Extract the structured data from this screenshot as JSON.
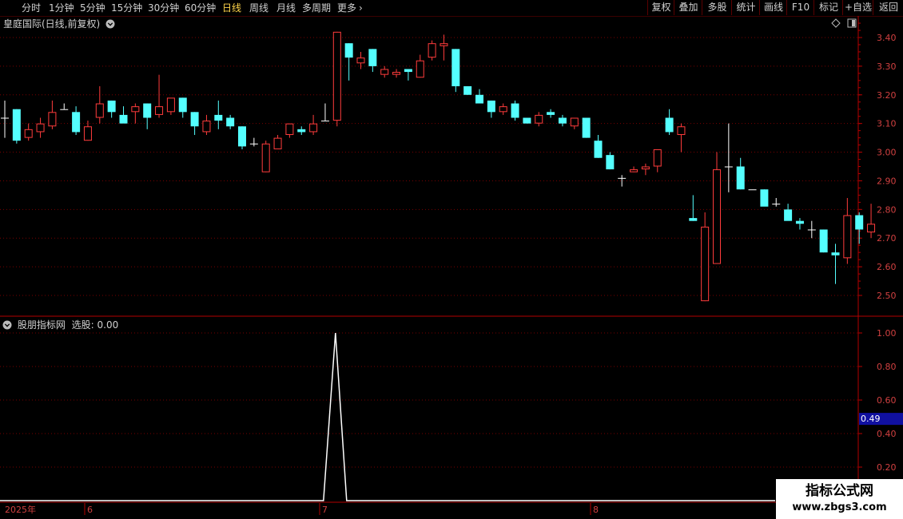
{
  "toolbar": {
    "periods": [
      "分时",
      "1分钟",
      "5分钟",
      "15分钟",
      "30分钟",
      "60分钟",
      "日线",
      "周线",
      "月线",
      "多周期",
      "更多"
    ],
    "active": "日线",
    "right": [
      "复权",
      "叠加",
      "多股",
      "统计",
      "画线",
      "F10",
      "标记",
      "+自选",
      "返回"
    ]
  },
  "main": {
    "title": "皇庭国际(日线,前复权)",
    "yticks": [
      "3.40",
      "3.30",
      "3.20",
      "3.10",
      "3.00",
      "2.90",
      "2.80",
      "2.70",
      "2.60",
      "2.50"
    ]
  },
  "indicator": {
    "title": "股朋指标网",
    "value_text": "选股: 0.00",
    "yticks": [
      "1.00",
      "0.80",
      "0.60",
      "0.40",
      "0.20"
    ],
    "cursor_value": "0.49"
  },
  "xaxis": {
    "year": "2025年",
    "months": [
      "6",
      "7",
      "8"
    ]
  },
  "watermark": {
    "line1": "指标公式网",
    "line2": "www.zbgs3.com"
  },
  "colors": {
    "up": "#ff3c3c",
    "down": "#54ffff",
    "doji": "#ffffff",
    "grid": "#780000",
    "axis": "#b40000",
    "active_tab": "#ffd54a",
    "cursor_box": "#1010a0"
  },
  "chart_data": {
    "type": "candlestick",
    "ylim": [
      2.45,
      3.45
    ],
    "candles": [
      [
        3.12,
        3.18,
        3.05,
        3.12
      ],
      [
        3.15,
        3.15,
        3.03,
        3.04
      ],
      [
        3.05,
        3.1,
        3.04,
        3.08
      ],
      [
        3.07,
        3.12,
        3.05,
        3.1
      ],
      [
        3.09,
        3.18,
        3.08,
        3.14
      ],
      [
        3.15,
        3.17,
        3.15,
        3.15
      ],
      [
        3.14,
        3.16,
        3.06,
        3.07
      ],
      [
        3.04,
        3.11,
        3.04,
        3.09
      ],
      [
        3.12,
        3.23,
        3.1,
        3.17
      ],
      [
        3.18,
        3.18,
        3.12,
        3.14
      ],
      [
        3.13,
        3.16,
        3.11,
        3.1
      ],
      [
        3.14,
        3.17,
        3.1,
        3.16
      ],
      [
        3.17,
        3.17,
        3.08,
        3.12
      ],
      [
        3.13,
        3.27,
        3.12,
        3.16
      ],
      [
        3.14,
        3.18,
        3.13,
        3.19
      ],
      [
        3.19,
        3.19,
        3.12,
        3.14
      ],
      [
        3.14,
        3.14,
        3.06,
        3.09
      ],
      [
        3.07,
        3.13,
        3.06,
        3.11
      ],
      [
        3.13,
        3.18,
        3.08,
        3.11
      ],
      [
        3.12,
        3.13,
        3.08,
        3.09
      ],
      [
        3.09,
        3.09,
        3.01,
        3.02
      ],
      [
        3.03,
        3.05,
        3.02,
        3.03
      ],
      [
        2.93,
        3.04,
        2.93,
        3.03
      ],
      [
        3.01,
        3.06,
        3.02,
        3.05
      ],
      [
        3.06,
        3.1,
        3.05,
        3.1
      ],
      [
        3.08,
        3.09,
        3.06,
        3.07
      ],
      [
        3.07,
        3.13,
        3.06,
        3.1
      ],
      [
        3.11,
        3.17,
        3.11,
        3.11
      ],
      [
        3.11,
        3.42,
        3.09,
        3.42
      ],
      [
        3.38,
        3.38,
        3.25,
        3.33
      ],
      [
        3.31,
        3.35,
        3.29,
        3.33
      ],
      [
        3.36,
        3.36,
        3.28,
        3.3
      ],
      [
        3.27,
        3.3,
        3.26,
        3.29
      ],
      [
        3.27,
        3.29,
        3.26,
        3.28
      ],
      [
        3.29,
        3.29,
        3.25,
        3.28
      ],
      [
        3.26,
        3.34,
        3.26,
        3.32
      ],
      [
        3.33,
        3.39,
        3.32,
        3.38
      ],
      [
        3.37,
        3.41,
        3.32,
        3.38
      ],
      [
        3.36,
        3.36,
        3.21,
        3.23
      ],
      [
        3.23,
        3.23,
        3.2,
        3.2
      ],
      [
        3.2,
        3.22,
        3.17,
        3.17
      ],
      [
        3.18,
        3.18,
        3.12,
        3.14
      ],
      [
        3.14,
        3.17,
        3.13,
        3.16
      ],
      [
        3.17,
        3.18,
        3.11,
        3.12
      ],
      [
        3.12,
        3.12,
        3.1,
        3.1
      ],
      [
        3.1,
        3.14,
        3.09,
        3.13
      ],
      [
        3.14,
        3.15,
        3.12,
        3.13
      ],
      [
        3.12,
        3.13,
        3.09,
        3.1
      ],
      [
        3.09,
        3.12,
        3.08,
        3.12
      ],
      [
        3.12,
        3.12,
        3.05,
        3.05
      ],
      [
        3.04,
        3.06,
        2.98,
        2.98
      ],
      [
        2.99,
        3.0,
        2.94,
        2.94
      ],
      [
        2.91,
        2.92,
        2.88,
        2.91
      ],
      [
        2.93,
        2.95,
        2.93,
        2.94
      ],
      [
        2.94,
        2.96,
        2.92,
        2.95
      ],
      [
        2.95,
        3.01,
        2.93,
        3.01
      ],
      [
        3.12,
        3.15,
        3.06,
        3.07
      ],
      [
        3.06,
        3.1,
        3.0,
        3.09
      ],
      [
        2.77,
        2.85,
        2.76,
        2.76
      ],
      [
        2.48,
        2.79,
        2.48,
        2.74
      ],
      [
        2.61,
        3.0,
        2.61,
        2.94
      ],
      [
        2.95,
        3.1,
        2.86,
        2.95
      ],
      [
        2.95,
        2.98,
        2.87,
        2.87
      ],
      [
        2.87,
        2.87,
        2.87,
        2.87
      ],
      [
        2.87,
        2.87,
        2.82,
        2.81
      ],
      [
        2.82,
        2.84,
        2.81,
        2.82
      ],
      [
        2.8,
        2.82,
        2.78,
        2.76
      ],
      [
        2.76,
        2.77,
        2.73,
        2.75
      ],
      [
        2.73,
        2.76,
        2.7,
        2.73
      ],
      [
        2.73,
        2.73,
        2.65,
        2.65
      ],
      [
        2.65,
        2.68,
        2.54,
        2.64
      ],
      [
        2.63,
        2.84,
        2.61,
        2.78
      ],
      [
        2.78,
        2.79,
        2.68,
        2.73
      ],
      [
        2.72,
        2.82,
        2.7,
        2.75
      ]
    ],
    "indicator_series": {
      "name": "选股",
      "ylim": [
        0.0,
        1.05
      ],
      "spike_index": 28,
      "values_note_free": true
    }
  }
}
